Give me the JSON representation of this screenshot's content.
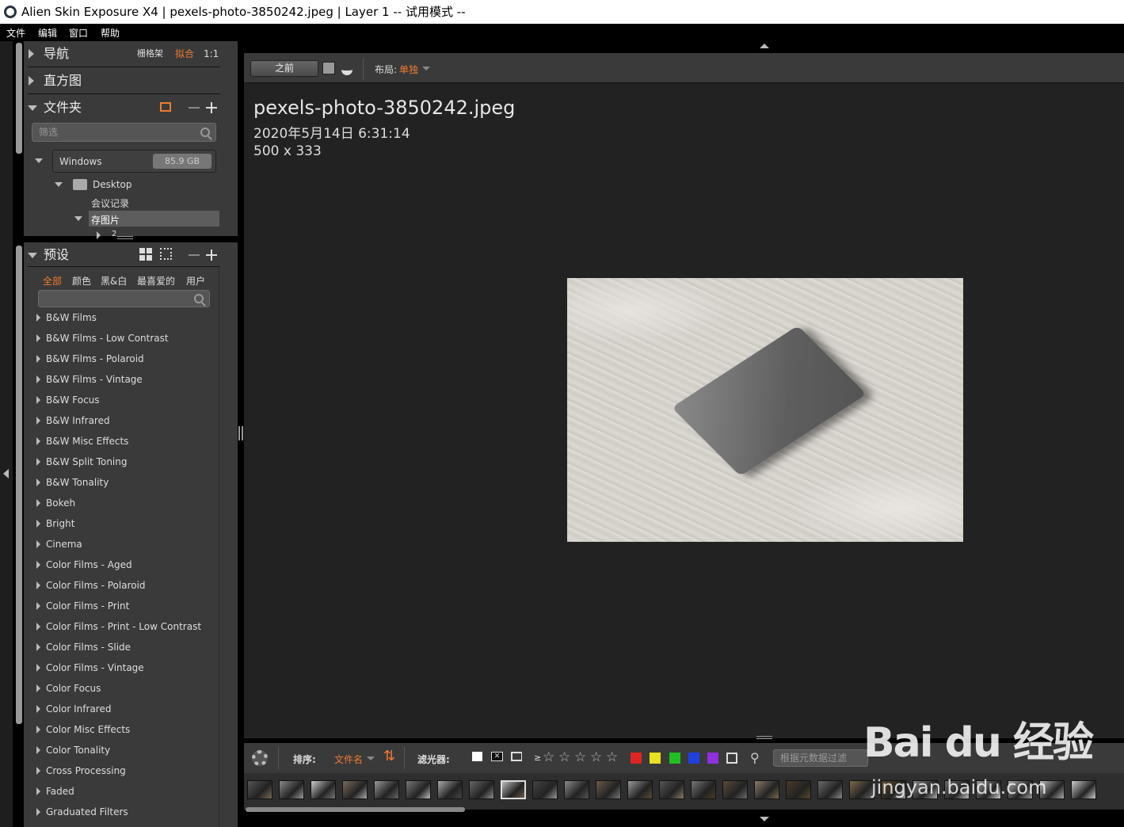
{
  "window": {
    "title": "Alien Skin Exposure X4 | pexels-photo-3850242.jpeg | Layer 1 -- 试用模式 --"
  },
  "menu": [
    "文件",
    "编辑",
    "窗口",
    "帮助"
  ],
  "nav_panel": {
    "label": "导航",
    "opt_grid": "栅格架",
    "opt_fit": "拟合",
    "opt_1to1": "1:1"
  },
  "histogram_panel": {
    "label": "直方图"
  },
  "folder_panel": {
    "label": "文件夹",
    "filter_placeholder": "筛选",
    "drive": {
      "name": "Windows",
      "size": "85.9 GB"
    },
    "tree": [
      "Desktop",
      "会议记录",
      "存图片",
      "2"
    ]
  },
  "presets_panel": {
    "label": "预设",
    "tabs": [
      "全部",
      "颜色",
      "黑&白",
      "最喜爱的",
      "用户"
    ],
    "items": [
      "B&W Films",
      "B&W Films - Low Contrast",
      "B&W Films - Polaroid",
      "B&W Films - Vintage",
      "B&W Focus",
      "B&W Infrared",
      "B&W Misc Effects",
      "B&W Split Toning",
      "B&W Tonality",
      "Bokeh",
      "Bright",
      "Cinema",
      "Color Films - Aged",
      "Color Films - Polaroid",
      "Color Films - Print",
      "Color Films - Print - Low Contrast",
      "Color Films - Slide",
      "Color Films - Vintage",
      "Color Focus",
      "Color Infrared",
      "Color Misc Effects",
      "Color Tonality",
      "Cross Processing",
      "Faded",
      "Graduated Filters"
    ]
  },
  "toolbar": {
    "before_label": "之前",
    "layout_label": "布局:",
    "layout_value": "单独"
  },
  "image_info": {
    "filename": "pexels-photo-3850242.jpeg",
    "date": "2020年5月14日 6:31:14",
    "dimensions": "500 x 333"
  },
  "bottom": {
    "sort_label": "排序:",
    "sort_value": "文件名",
    "filter_label": "滤光器:",
    "rating_prefix": "≥",
    "metadata_placeholder": "根据元数据过滤",
    "color_labels": [
      "#e02424",
      "#e8e020",
      "#20c020",
      "#2040e0",
      "#9030e0"
    ]
  },
  "watermark": {
    "logo": "Bai du 经验",
    "url": "jingyan.baidu.com"
  }
}
